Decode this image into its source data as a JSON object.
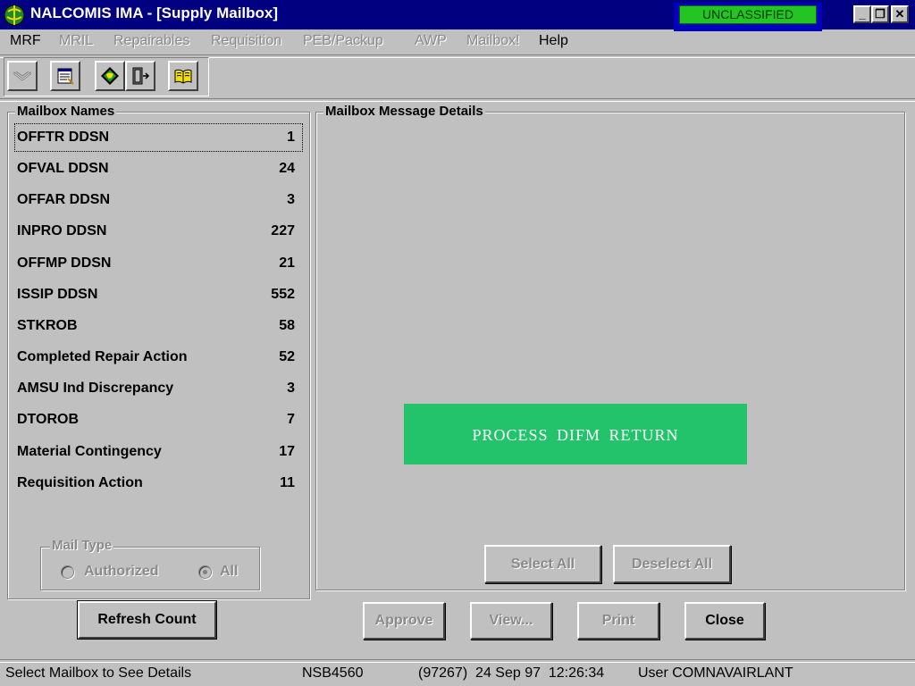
{
  "window": {
    "title": "NALCOMIS IMA - [Supply Mailbox]",
    "classification": "UNCLASSIFIED",
    "controls": {
      "minimize": "_",
      "restore": "❐",
      "close": "✕"
    }
  },
  "menu": [
    {
      "label": "MRF",
      "enabled": true
    },
    {
      "label": "MRIL",
      "enabled": false
    },
    {
      "label": "Repairables",
      "enabled": false
    },
    {
      "label": "Requisition",
      "enabled": false
    },
    {
      "label": "PEB/Packup",
      "enabled": false
    },
    {
      "label": "AWP",
      "enabled": false
    },
    {
      "label": "Mailbox!",
      "enabled": false
    },
    {
      "label": "Help",
      "enabled": true
    }
  ],
  "toolbar": [
    {
      "icon": "envelope-icon"
    },
    {
      "icon": "notepad-icon"
    },
    {
      "icon": "globe-icon"
    },
    {
      "icon": "exit-door-icon"
    },
    {
      "icon": "book-icon"
    }
  ],
  "mailbox_names": {
    "legend": "Mailbox Names",
    "items": [
      {
        "name": "OFFTR DDSN",
        "count": "1"
      },
      {
        "name": "OFVAL DDSN",
        "count": "24"
      },
      {
        "name": "OFFAR DDSN",
        "count": "3"
      },
      {
        "name": "INPRO DDSN",
        "count": "227"
      },
      {
        "name": "OFFMP DDSN",
        "count": "21"
      },
      {
        "name": "ISSIP DDSN",
        "count": "552"
      },
      {
        "name": "STKROB",
        "count": "58"
      },
      {
        "name": "Completed Repair Action",
        "count": "52"
      },
      {
        "name": "AMSU Ind Discrepancy",
        "count": "3"
      },
      {
        "name": "DTOROB",
        "count": "7"
      },
      {
        "name": "Material Contingency",
        "count": "17"
      },
      {
        "name": "Requisition Action",
        "count": "11"
      }
    ]
  },
  "mail_type": {
    "legend": "Mail Type",
    "options": [
      {
        "label": "Authorized",
        "selected": false
      },
      {
        "label": "All",
        "selected": true
      }
    ]
  },
  "refresh_button": "Refresh Count",
  "details": {
    "legend": "Mailbox Message Details",
    "banner": "PROCESS DIFM RETURN",
    "select_all": "Select All",
    "deselect_all": "Deselect All"
  },
  "actions": {
    "approve": "Approve",
    "view": "View...",
    "print": "Print",
    "close": "Close"
  },
  "status_bar": {
    "message": "Select Mailbox to See Details",
    "terminal": "NSB4560",
    "datetime": "(97267)  24 Sep 97  12:26:34",
    "user": "User COMNAVAIRLANT"
  },
  "colors": {
    "title_bar": "#000080",
    "classification_badge": "#22c522",
    "banner": "#22c36a",
    "window_face": "#c0c0c0"
  }
}
